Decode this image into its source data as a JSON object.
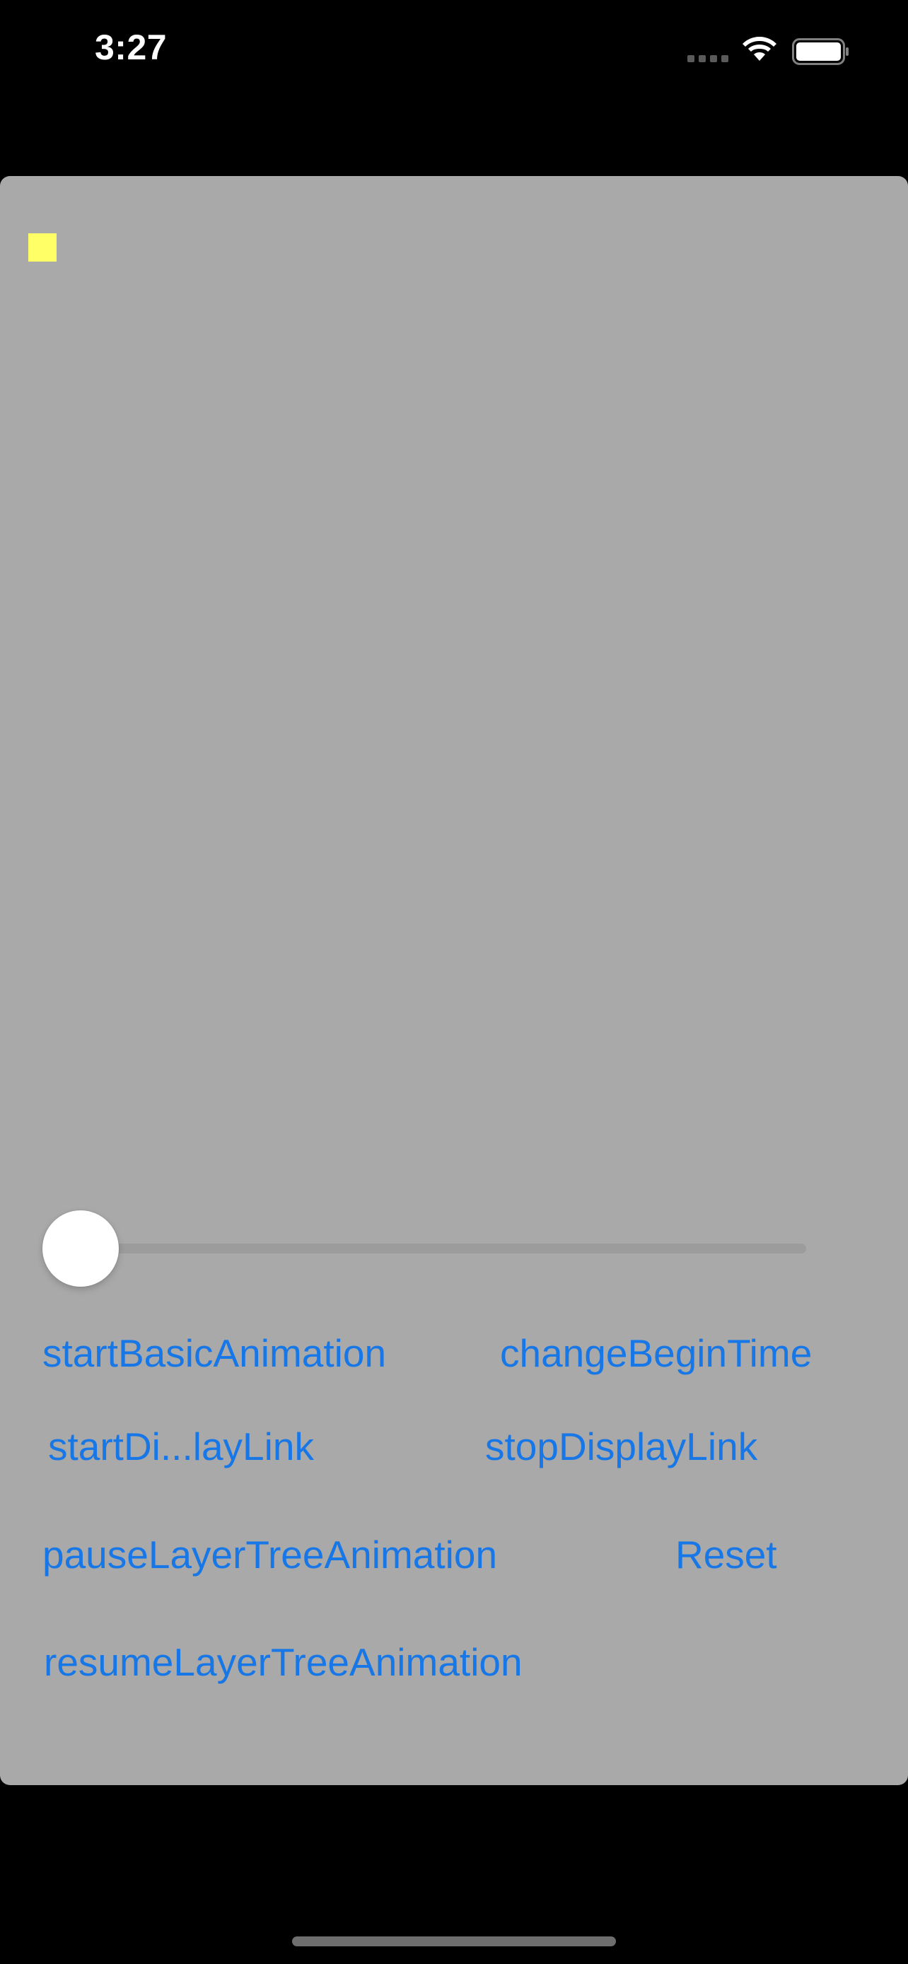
{
  "status_bar": {
    "time": "3:27",
    "icons": [
      "signal-icon",
      "wifi-icon",
      "battery-icon"
    ]
  },
  "colors": {
    "background": "#000000",
    "panel": "#a9a9a9",
    "accent": "#1877e6",
    "animated_layer": "#ffff66",
    "thumb": "#ffffff"
  },
  "slider": {
    "value": 0.0
  },
  "buttons": {
    "start_basic_animation": "startBasicAnimation",
    "change_begin_time": "changeBeginTime",
    "start_display_link": "startDi...layLink",
    "stop_display_link": "stopDisplayLink",
    "pause_layer_tree_animation": "pauseLayerTreeAnimation",
    "reset": "Reset",
    "resume_layer_tree_animation": "resumeLayerTreeAnimation"
  }
}
